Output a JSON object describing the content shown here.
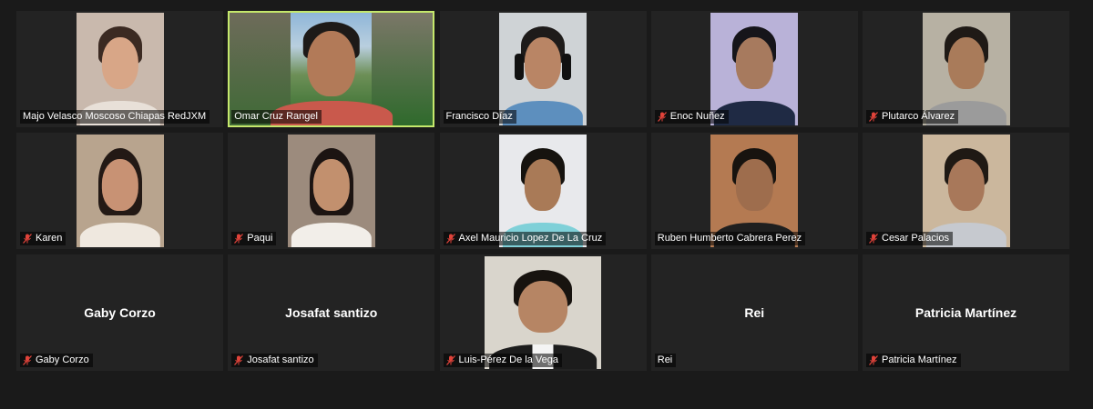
{
  "colors": {
    "background": "#1a1a1a",
    "tile": "#232323",
    "active_speaker_border": "#c5e86c",
    "muted_icon": "#e0433a"
  },
  "participants": [
    {
      "name": "Majo Velasco Moscoso Chiapas RedJXM",
      "muted": false,
      "video": true
    },
    {
      "name": "Omar Cruz Rangel",
      "muted": false,
      "video": true,
      "active_speaker": true
    },
    {
      "name": "Francisco Díaz",
      "muted": false,
      "video": true
    },
    {
      "name": "Enoc Nuñez",
      "muted": true,
      "video": true
    },
    {
      "name": "Plutarco Álvarez",
      "muted": true,
      "video": true
    },
    {
      "name": "Karen",
      "muted": true,
      "video": true
    },
    {
      "name": "Paqui",
      "muted": true,
      "video": true
    },
    {
      "name": "Axel Mauricio Lopez De La Cruz",
      "muted": true,
      "video": true
    },
    {
      "name": "Ruben Humberto Cabrera Perez",
      "muted": false,
      "video": true
    },
    {
      "name": "Cesar Palacios",
      "muted": true,
      "video": true
    },
    {
      "name": "Gaby Corzo",
      "muted": true,
      "video": false
    },
    {
      "name": "Josafat santizo",
      "muted": true,
      "video": false
    },
    {
      "name": "Luis-Pérez De la Vega",
      "muted": true,
      "video": true
    },
    {
      "name": "Rei",
      "muted": false,
      "video": false
    },
    {
      "name": "Patricia Martínez",
      "muted": true,
      "video": false
    }
  ]
}
